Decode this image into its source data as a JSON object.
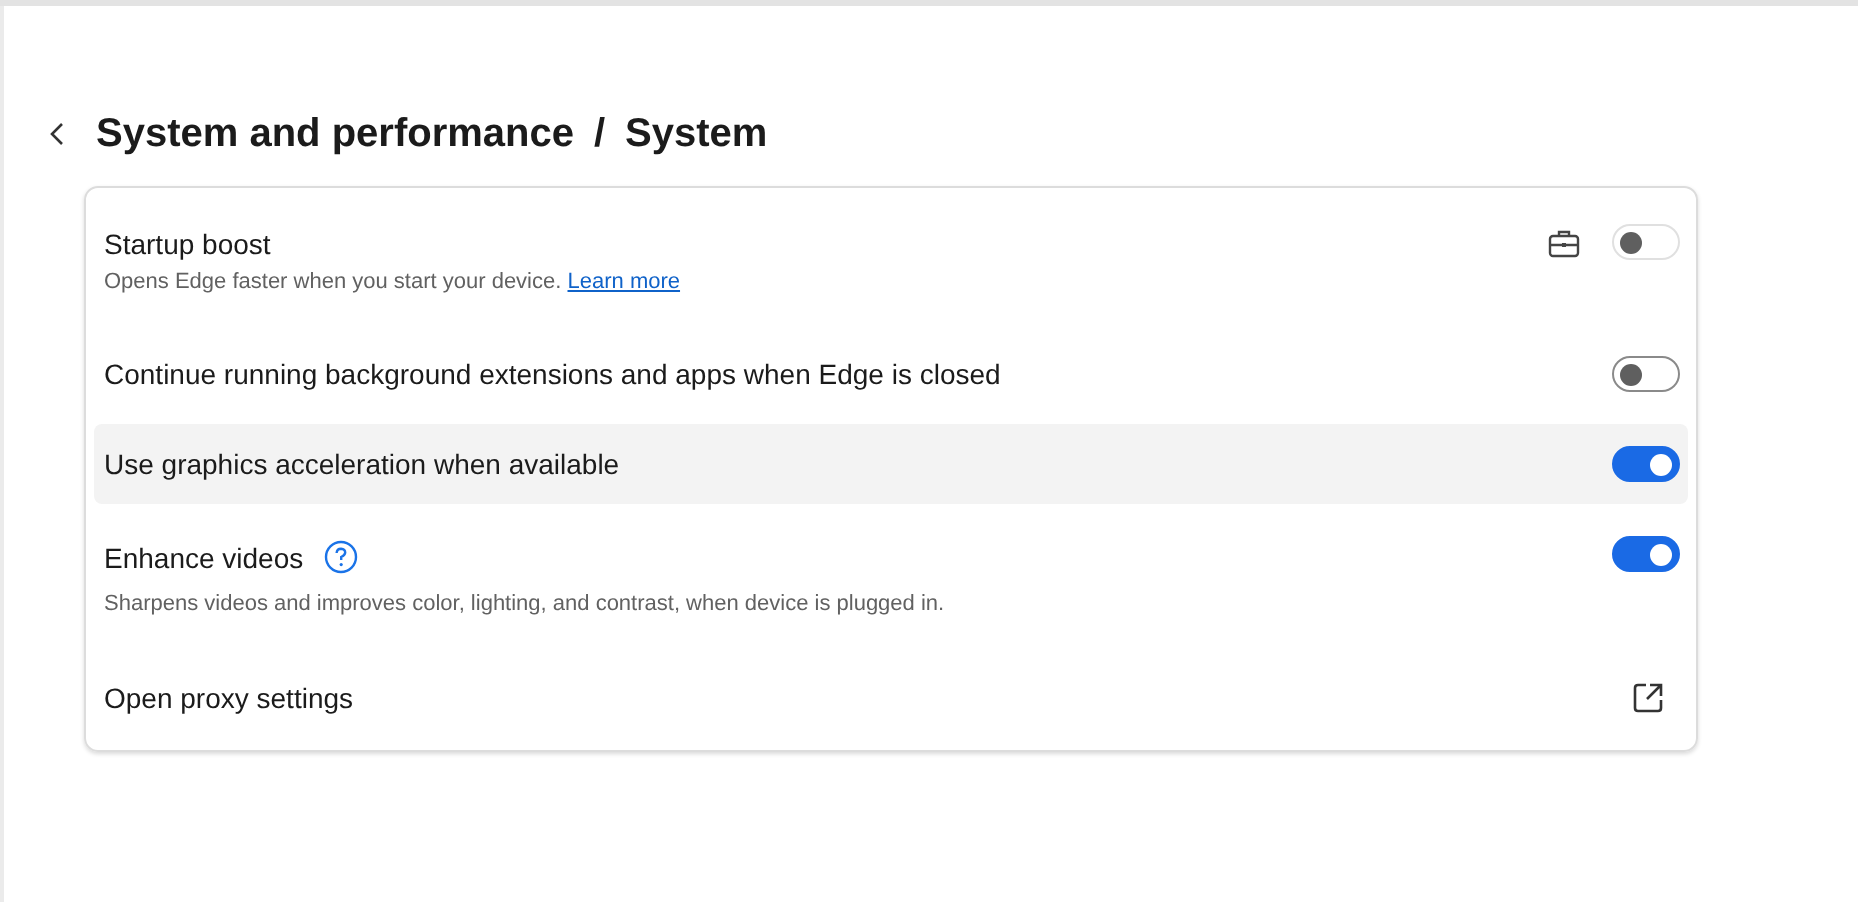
{
  "breadcrumb": {
    "parent": "System and performance",
    "separator": "/",
    "current": "System"
  },
  "settings": [
    {
      "kind": "toggle",
      "label": "Startup boost",
      "description": "Opens Edge faster when you start your device.",
      "link": "Learn more",
      "managed": true,
      "on": false,
      "highlighted": false
    },
    {
      "kind": "toggle",
      "label": "Continue running background extensions and apps when Edge is closed",
      "on": false,
      "highlighted": false
    },
    {
      "kind": "toggle",
      "label": "Use graphics acceleration when available",
      "on": true,
      "highlighted": true
    },
    {
      "kind": "toggle",
      "label": "Enhance videos",
      "help": true,
      "description": "Sharpens videos and improves color, lighting, and contrast, when device is plugged in.",
      "on": true,
      "highlighted": false
    },
    {
      "kind": "external",
      "label": "Open proxy settings",
      "highlighted": false
    }
  ]
}
